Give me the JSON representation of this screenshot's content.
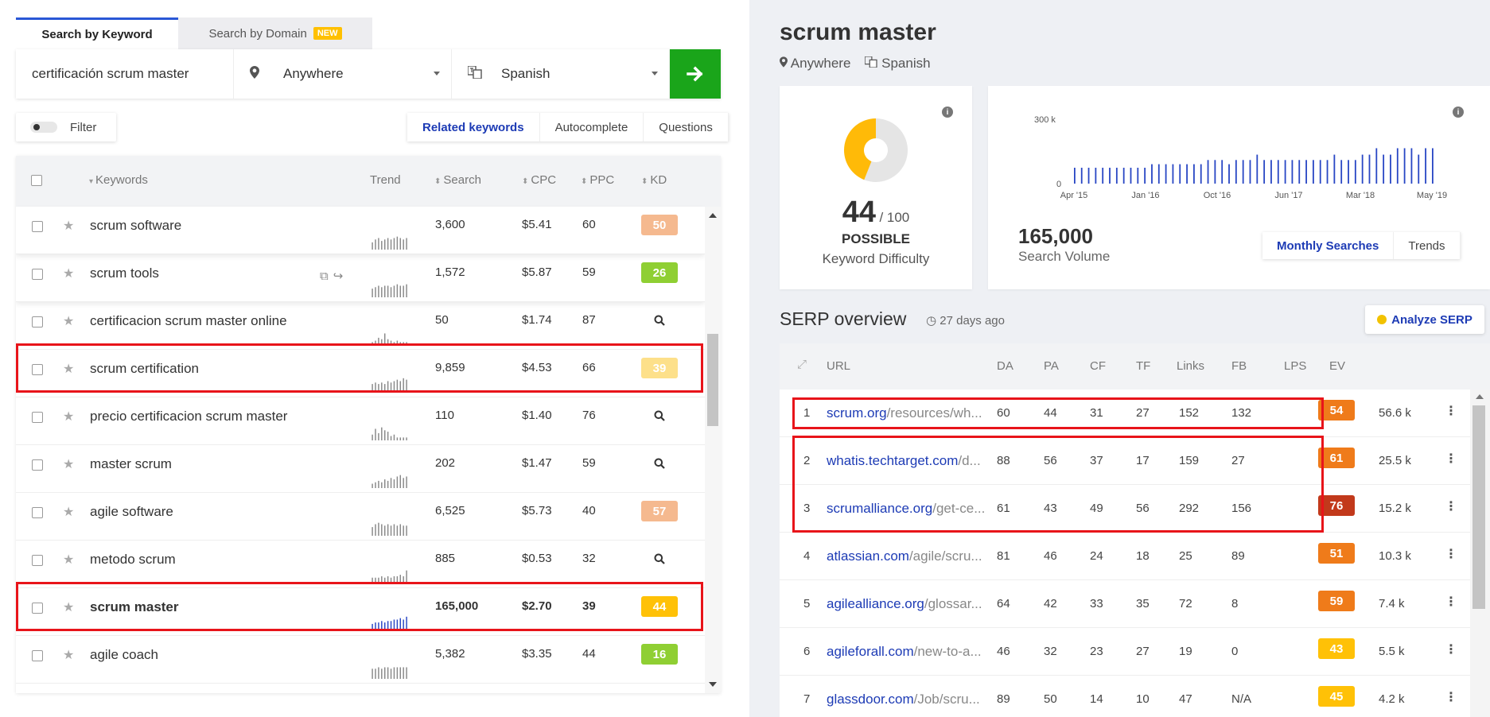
{
  "search": {
    "tab_keyword": "Search by Keyword",
    "tab_domain": "Search by Domain",
    "badge_new": "NEW",
    "keyword_value": "certificación scrum master",
    "location": "Anywhere",
    "language": "Spanish"
  },
  "controls": {
    "filter_label": "Filter",
    "tabs": [
      "Related keywords",
      "Autocomplete",
      "Questions"
    ]
  },
  "table": {
    "headers": {
      "keywords": "Keywords",
      "trend": "Trend",
      "search": "Search",
      "cpc": "CPC",
      "ppc": "PPC",
      "kd": "KD"
    },
    "rows": [
      {
        "keyword": "scrum software",
        "search": "3,600",
        "cpc": "$5.41",
        "ppc": "60",
        "kd": "50",
        "kd_color": "#f5b98f",
        "trend": [
          5,
          7,
          8,
          6,
          7,
          8,
          7,
          8,
          9,
          8,
          7,
          8
        ],
        "bold": false
      },
      {
        "keyword": "scrum tools",
        "search": "1,572",
        "cpc": "$5.87",
        "ppc": "59",
        "kd": "26",
        "kd_color": "#8fcf33",
        "trend": [
          6,
          7,
          8,
          7,
          8,
          8,
          7,
          8,
          9,
          8,
          8,
          9
        ],
        "bold": false,
        "actions": true
      },
      {
        "keyword": "certificacion scrum master online",
        "search": "50",
        "cpc": "$1.74",
        "ppc": "87",
        "kd": "",
        "kd_color": "",
        "trend": [
          2,
          3,
          5,
          4,
          8,
          4,
          3,
          2,
          3,
          2,
          2,
          2
        ],
        "bold": false
      },
      {
        "keyword": "scrum certification",
        "search": "9,859",
        "cpc": "$4.53",
        "ppc": "66",
        "kd": "39",
        "kd_color": "#fde08a",
        "trend": [
          6,
          7,
          6,
          7,
          6,
          8,
          7,
          8,
          9,
          8,
          10,
          9
        ],
        "bold": false
      },
      {
        "keyword": "precio certificacion scrum master",
        "search": "110",
        "cpc": "$1.40",
        "ppc": "76",
        "kd": "",
        "kd_color": "",
        "trend": [
          4,
          8,
          5,
          9,
          7,
          6,
          3,
          4,
          2,
          2,
          2,
          2
        ],
        "bold": false
      },
      {
        "keyword": "master scrum",
        "search": "202",
        "cpc": "$1.47",
        "ppc": "59",
        "kd": "",
        "kd_color": "",
        "trend": [
          3,
          4,
          5,
          4,
          6,
          5,
          7,
          6,
          8,
          9,
          7,
          8
        ],
        "bold": false
      },
      {
        "keyword": "agile software",
        "search": "6,525",
        "cpc": "$5.73",
        "ppc": "40",
        "kd": "57",
        "kd_color": "#f5b98f",
        "trend": [
          6,
          8,
          9,
          8,
          7,
          8,
          7,
          8,
          7,
          8,
          7,
          7
        ],
        "bold": false
      },
      {
        "keyword": "metodo scrum",
        "search": "885",
        "cpc": "$0.53",
        "ppc": "32",
        "kd": "",
        "kd_color": "",
        "trend": [
          4,
          4,
          4,
          5,
          4,
          5,
          4,
          5,
          5,
          6,
          5,
          9
        ],
        "bold": false
      },
      {
        "keyword": "scrum master",
        "search": "165,000",
        "cpc": "$2.70",
        "ppc": "39",
        "kd": "44",
        "kd_color": "#ffc107",
        "trend": [
          5,
          6,
          6,
          7,
          6,
          7,
          7,
          8,
          8,
          9,
          8,
          10
        ],
        "bold": true,
        "blue": true
      },
      {
        "keyword": "agile coach",
        "search": "5,382",
        "cpc": "$3.35",
        "ppc": "44",
        "kd": "16",
        "kd_color": "#8fcf33",
        "trend": [
          7,
          7,
          8,
          7,
          8,
          8,
          7,
          8,
          8,
          8,
          8,
          8
        ],
        "bold": false
      }
    ]
  },
  "detail": {
    "title": "scrum master",
    "location": "Anywhere",
    "language": "Spanish",
    "kd_value": "44",
    "kd_max": "/ 100",
    "kd_fraction": 0.44,
    "kd_word": "POSSIBLE",
    "kd_label": "Keyword Difficulty",
    "volume_value": "165,000",
    "volume_label": "Search Volume",
    "volume_tabs": [
      "Monthly Searches",
      "Trends"
    ],
    "kd_color": "#ffba08"
  },
  "chart_data": {
    "type": "bar",
    "categories": [
      "Apr '15",
      "Jan '16",
      "Oct '16",
      "Jun '17",
      "Mar '18",
      "May '19"
    ],
    "values": [
      74000,
      74000,
      74000,
      74000,
      74000,
      74000,
      74000,
      74000,
      74000,
      74000,
      74000,
      90500,
      90500,
      90500,
      90500,
      90500,
      90500,
      90500,
      90500,
      110000,
      110000,
      110000,
      90500,
      110000,
      110000,
      110000,
      135000,
      110000,
      110000,
      110000,
      110000,
      110000,
      110000,
      110000,
      110000,
      110000,
      110000,
      135000,
      110000,
      110000,
      110000,
      135000,
      135000,
      165000,
      135000,
      135000,
      165000,
      165000,
      165000,
      135000,
      165000,
      165000
    ],
    "ytick_labels": [
      "300 k",
      "0"
    ],
    "ylim": [
      0,
      300000
    ],
    "grid": false
  },
  "serp": {
    "title": "SERP overview",
    "ago": "27 days ago",
    "analyze_label": "Analyze SERP",
    "headers": [
      "URL",
      "DA",
      "PA",
      "CF",
      "TF",
      "Links",
      "FB",
      "LPS",
      "EV"
    ],
    "rows": [
      {
        "n": "1",
        "domain": "scrum.org",
        "path": "/resources/wh...",
        "da": "60",
        "pa": "44",
        "cf": "31",
        "tf": "27",
        "links": "152",
        "fb": "132",
        "lps": "54",
        "lps_color": "#ef7b1a",
        "ev": "56.6 k"
      },
      {
        "n": "2",
        "domain": "whatis.techtarget.com",
        "path": "/d...",
        "da": "88",
        "pa": "56",
        "cf": "37",
        "tf": "17",
        "links": "159",
        "fb": "27",
        "lps": "61",
        "lps_color": "#ef7b1a",
        "ev": "25.5 k"
      },
      {
        "n": "3",
        "domain": "scrumalliance.org",
        "path": "/get-ce...",
        "da": "61",
        "pa": "43",
        "cf": "49",
        "tf": "56",
        "links": "292",
        "fb": "156",
        "lps": "76",
        "lps_color": "#c2391b",
        "ev": "15.2 k"
      },
      {
        "n": "4",
        "domain": "atlassian.com",
        "path": "/agile/scru...",
        "da": "81",
        "pa": "46",
        "cf": "24",
        "tf": "18",
        "links": "25",
        "fb": "89",
        "lps": "51",
        "lps_color": "#ef7b1a",
        "ev": "10.3 k"
      },
      {
        "n": "5",
        "domain": "agilealliance.org",
        "path": "/glossar...",
        "da": "64",
        "pa": "42",
        "cf": "33",
        "tf": "35",
        "links": "72",
        "fb": "8",
        "lps": "59",
        "lps_color": "#ef7b1a",
        "ev": "7.4 k"
      },
      {
        "n": "6",
        "domain": "agileforall.com",
        "path": "/new-to-a...",
        "da": "46",
        "pa": "32",
        "cf": "23",
        "tf": "27",
        "links": "19",
        "fb": "0",
        "lps": "43",
        "lps_color": "#ffc107",
        "ev": "5.5 k"
      },
      {
        "n": "7",
        "domain": "glassdoor.com",
        "path": "/Job/scru...",
        "da": "89",
        "pa": "50",
        "cf": "14",
        "tf": "10",
        "links": "47",
        "fb": "N/A",
        "lps": "45",
        "lps_color": "#ffc107",
        "ev": "4.2 k"
      }
    ]
  }
}
